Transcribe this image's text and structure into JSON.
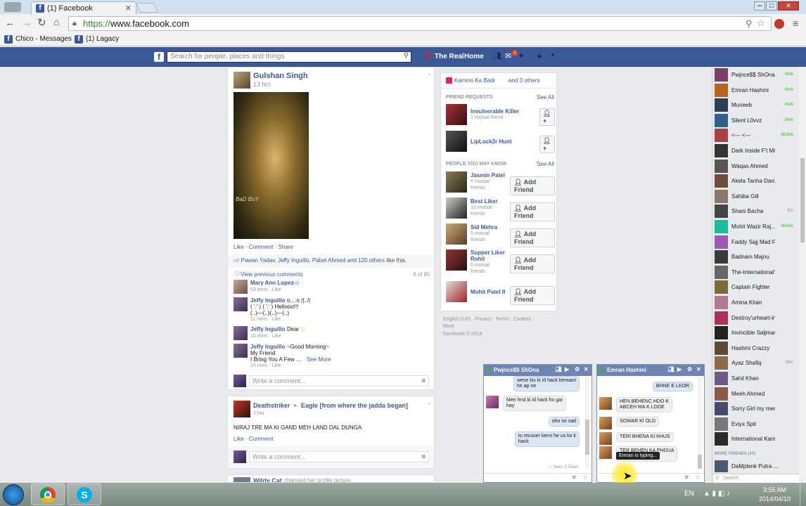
{
  "browser": {
    "tab_title": "(1) Facebook",
    "url_scheme": "https://",
    "url_rest": "www.facebook.com",
    "bookmarks": [
      "Chico - Messages",
      "(1) Lagacy"
    ]
  },
  "fb_header": {
    "search_placeholder": "Search for people, places and things",
    "profile_name": "The Real",
    "home": "Home",
    "notif_badge": "1"
  },
  "post1": {
    "author": "Gulshan Singh",
    "time": "13 hrs",
    "image_caption": "BaD BoY",
    "actions": [
      "Like",
      "·",
      "Comment",
      "·",
      "Share"
    ],
    "likes_text": "Pawan Yadav, Jeffy Inguillo, Pabel Ahmed and",
    "likes_others": "120 others",
    "likes_suffix": "like this.",
    "view_prev": "View previous comments",
    "count": "4 of 85",
    "comments": [
      {
        "name": "Mary Ann Lopez",
        "text": "",
        "meta": "53 mins · Like"
      },
      {
        "name": "Jeffy Inguillo",
        "text": "o....o /|../|",
        "text2": "( '.' ) ( '.' ) Hellooo!!!",
        "text3": "(..)—(..)(..)—(..)",
        "meta": "11 mins · Like"
      },
      {
        "name": "Jeffy Inguillo",
        "text": "Dear",
        "meta": "10 mins · Like"
      },
      {
        "name": "Jeffy Inguillo",
        "text": "~Good Morning~",
        "text2": "My Friend",
        "text3": "I Bring You A Few ...",
        "see_more": "See More",
        "meta": "10 mins · Like"
      }
    ],
    "write_comment": "Write a comment..."
  },
  "post2": {
    "author": "Deathstriker",
    "arrow": "▸",
    "target": "Eagle [from where the jadda began]",
    "time": "2 hrs",
    "text": "NIRAJ TRE MA KI GAND MEH LAND DAL DUNGA",
    "actions": [
      "Like",
      "·",
      "Comment"
    ],
    "write_comment": "Write a comment..."
  },
  "post3": {
    "author": "Wildy Cat",
    "text": "changed her profile picture."
  },
  "right_col": {
    "top_name": "Kamino Ka Badr",
    "top_suffix": "and 3 others",
    "friend_requests": "FRIEND REQUESTS",
    "see_all": "See All",
    "requests": [
      {
        "name": "Invulnerable Killer",
        "sub": "1 mutual friend"
      },
      {
        "name": "LipLock3r Hunt",
        "sub": ""
      }
    ],
    "pymk": "PEOPLE YOU MAY KNOW",
    "people": [
      {
        "name": "Jasmin Patel",
        "sub1": "6 mutual",
        "sub2": "friends"
      },
      {
        "name": "Best Liker",
        "sub1": "10 mutual",
        "sub2": "friends"
      },
      {
        "name": "Sid Mehra",
        "sub1": "5 mutual",
        "sub2": "friends"
      },
      {
        "name": "Supper Liker",
        "name2": "Rohit",
        "sub1": "6 mutual",
        "sub2": "friends"
      },
      {
        "name": "Mohit Patel II",
        "sub1": "",
        "sub2": ""
      }
    ],
    "add_friend": "Add Friend",
    "footer1": "English (US) · Privacy · Terms · Cookies ·",
    "footer2": "More ·",
    "footer3": "Facebook © 2014"
  },
  "sidebar": {
    "friends": [
      {
        "name": "Pwjnce$$ ShOna",
        "status": "Web"
      },
      {
        "name": "Emran Hashmi",
        "status": "Web"
      },
      {
        "name": "Muneeb",
        "status": "Web"
      },
      {
        "name": "Silent L0vvz",
        "status": "Web"
      },
      {
        "name": "<--- <---",
        "status": "Mobile"
      },
      {
        "name": "Dark Inside F't Mind",
        "status": ""
      },
      {
        "name": "Waqas Ahmed",
        "status": ""
      },
      {
        "name": "Akela Tanha Dardbhara",
        "status": ""
      },
      {
        "name": "Sahiba Gill",
        "status": ""
      },
      {
        "name": "Shani Bacha",
        "status": "5m"
      },
      {
        "name": "Mohit Wazir Raj...",
        "status": "Mobile"
      },
      {
        "name": "Faddy Sajj Mad Ft-Famo...",
        "status": ""
      },
      {
        "name": "Badnam Majnu",
        "status": ""
      },
      {
        "name": "The-International'Kamino...",
        "status": ""
      },
      {
        "name": "Captain Fighter",
        "status": ""
      },
      {
        "name": "Amina Khan",
        "status": ""
      },
      {
        "name": "Destroy'urheart-in Afew...",
        "status": ""
      },
      {
        "name": "Invincible Saljman",
        "status": ""
      },
      {
        "name": "Hashmi Crazzy",
        "status": ""
      },
      {
        "name": "Ayaz Shafiq",
        "status": "39m"
      },
      {
        "name": "Sahil Khan",
        "status": ""
      },
      {
        "name": "Meeh Ahmed",
        "status": ""
      },
      {
        "name": "Sorry Girl my memory-...",
        "status": ""
      },
      {
        "name": "Eviyx Spit",
        "status": ""
      },
      {
        "name": "International Kamina D...",
        "status": ""
      }
    ],
    "more_friends": "MORE FRIENDS (10)",
    "more_item": "DaMplenk Putra ...",
    "search": "Search"
  },
  "chat1": {
    "title": "Pwjnce$$ ShOna",
    "msgs": [
      {
        "me": true,
        "lines": [
          "wese kis ki id hack kerwani",
          "he ap ne"
        ]
      },
      {
        "me": false,
        "lines": [
          "Meri frnd ki id hack ho gai",
          "hay"
        ]
      },
      {
        "me": true,
        "lines": [
          "oho so sad"
        ]
      },
      {
        "me": true,
        "lines": [
          "to recover kerni he us ko k",
          "hack"
        ]
      }
    ],
    "seen": "✓ Seen 2:55am"
  },
  "chat2": {
    "title": "Emran Hashmi",
    "msgs": [
      {
        "me": true,
        "lines": [
          "BHNE E LKOR"
        ]
      },
      {
        "me": false,
        "lines": [
          "HEN BEHENC HDO K",
          "ABCEH MA K LDOE"
        ]
      },
      {
        "me": false,
        "lines": [
          "SOWAR KI OLD"
        ]
      },
      {
        "me": false,
        "lines": [
          "TERI BHENA KI KHUS"
        ]
      },
      {
        "me": false,
        "lines": [
          "TER BEHEN KA PHDUA",
          "AJUN GA"
        ]
      }
    ],
    "typing": "Emran is typing..."
  },
  "taskbar": {
    "lang": "EN",
    "time": "3:55 AM",
    "date": "2014/04/10"
  }
}
